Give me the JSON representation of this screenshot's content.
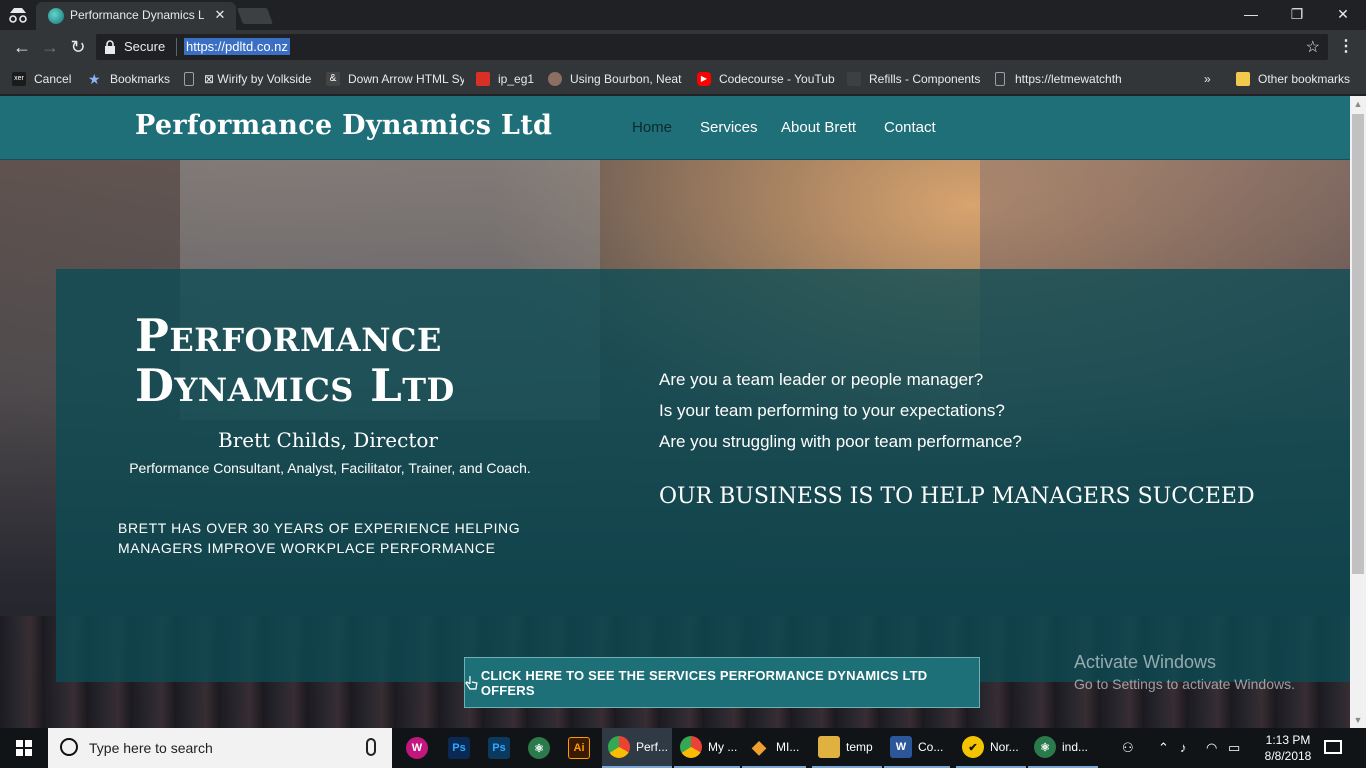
{
  "browser": {
    "tab": {
      "title": "Performance Dynamics Lt",
      "close_label": "✕"
    },
    "window_controls": {
      "minimize": "—",
      "maximize": "❐",
      "close": "✕"
    },
    "address": {
      "secure_label": "Secure",
      "url": "https://pdltd.co.nz"
    },
    "bookmarks": [
      {
        "label": "Cancel",
        "icon": "xer-icon",
        "color": "#1b1b1b"
      },
      {
        "label": "Bookmarks",
        "icon": "star-icon",
        "color": "#8ab4f8"
      },
      {
        "label": "⊠ Wirify by Volkside",
        "icon": "page-icon",
        "color": "#9aa0a6"
      },
      {
        "label": "Down Arrow HTML Sy",
        "icon": "ampersand-icon",
        "color": "#444"
      },
      {
        "label": "ip_eg1",
        "icon": "red-icon",
        "color": "#d93025"
      },
      {
        "label": "Using Bourbon, Neat",
        "icon": "avatar-icon",
        "color": "#8d6e63"
      },
      {
        "label": "Codecourse - YouTub",
        "icon": "youtube-icon",
        "color": "#ff0000"
      },
      {
        "label": "Refills - Components",
        "icon": "refills-icon",
        "color": "#3c4043"
      },
      {
        "label": "https://letmewatchth",
        "icon": "page-icon",
        "color": "#9aa0a6"
      }
    ],
    "more_label": "»",
    "other_bookmarks": "Other bookmarks"
  },
  "site": {
    "logo": "Performance Dynamics Ltd",
    "nav": [
      "Home",
      "Services",
      "About Brett",
      "Contact"
    ],
    "hero_title": "Performance Dynamics Ltd",
    "director": "Brett Childs, Director",
    "roles": "Performance Consultant, Analyst, Facilitator, Trainer, and Coach.",
    "experience": "BRETT HAS OVER 30 YEARS OF EXPERIENCE HELPING MANAGERS IMPROVE WORKPLACE PERFORMANCE",
    "questions": [
      "Are you a team leader or people manager?",
      "Is your team performing to your expectations?",
      "Are you struggling with poor team performance?"
    ],
    "tagline": "OUR BUSINESS IS TO HELP MANAGERS SUCCEED",
    "cta": "CLICK HERE TO SEE THE SERVICES PERFORMANCE DYNAMICS LTD OFFERS"
  },
  "watermark": {
    "title": "Activate Windows",
    "subtitle": "Go to Settings to activate Windows."
  },
  "taskbar": {
    "search_placeholder": "Type here to search",
    "apps": [
      {
        "label": "",
        "icon": "W",
        "color": "#c2187e"
      },
      {
        "label": "",
        "icon": "Ps",
        "color": "#0a2a55"
      },
      {
        "label": "",
        "icon": "Ps",
        "color": "#0a3a60"
      },
      {
        "label": "",
        "icon": "⚛",
        "color": "#2a7a4b"
      },
      {
        "label": "",
        "icon": "Ai",
        "color": "#3a1a00"
      },
      {
        "label": "Perf...",
        "icon": "●",
        "color": "#e34133"
      },
      {
        "label": "My ...",
        "icon": "●",
        "color": "#e34133"
      },
      {
        "label": "MI...",
        "icon": "◆",
        "color": "#f0a030"
      },
      {
        "label": "temp",
        "icon": "▮",
        "color": "#e0b040"
      },
      {
        "label": "Co...",
        "icon": "W",
        "color": "#2b579a"
      },
      {
        "label": "Nor...",
        "icon": "✔",
        "color": "#f5c400"
      },
      {
        "label": "ind...",
        "icon": "⚛",
        "color": "#2a7a4b"
      }
    ],
    "time": "1:13 PM",
    "date": "8/8/2018"
  }
}
